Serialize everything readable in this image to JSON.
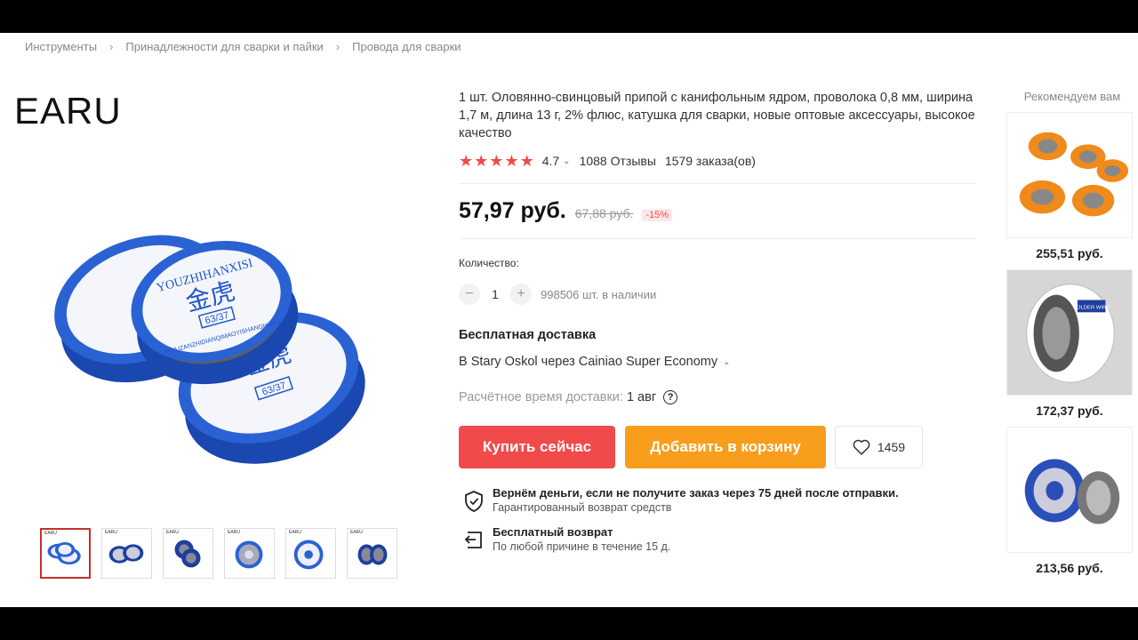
{
  "breadcrumb": [
    "Инструменты",
    "Принадлежности для сварки и пайки",
    "Провода для сварки"
  ],
  "brand": "EARU",
  "thumb_label": "EARU",
  "spool_texts": {
    "brand_text": "YOUZHIHANXISI",
    "chinese": "金虎",
    "alloy": "63/37",
    "side_text": "JINHUZANZHIDIANQIMAOYISHANGHANG"
  },
  "product": {
    "title": "1 шт. Оловянно-свинцовый припой с канифольным ядром, проволока 0,8 мм, ширина 1,7 м, длина 13 г, 2% флюс, катушка для сварки, новые оптовые аксессуары, высокое качество",
    "rating": "4.7",
    "stars": 5,
    "reviews": "1088 Отзывы",
    "orders": "1579 заказа(ов)",
    "price": "57,97 руб.",
    "old_price": "67,88 руб.",
    "discount": "-15%"
  },
  "quantity": {
    "label": "Количество:",
    "minus": "−",
    "value": "1",
    "plus": "+",
    "stock": "998506 шт. в наличии"
  },
  "shipping": {
    "title": "Бесплатная доставка",
    "method": "В Stary Oskol через Cainiao Super Economy",
    "eta_label": "Расчётное время доставки:",
    "eta_value": "1 авг",
    "help": "?"
  },
  "buttons": {
    "buy": "Купить сейчас",
    "cart": "Добавить в корзину",
    "wishlist_count": "1459"
  },
  "guarantees": [
    {
      "title": "Вернём деньги, если не получите заказ через 75 дней после отправки.",
      "subtitle": "Гарантированный возврат средств"
    },
    {
      "title": "Бесплатный возврат",
      "subtitle": "По любой причине в течение 15 д."
    }
  ],
  "recommend": {
    "title": "Рекомендуем вам",
    "items": [
      {
        "price": "255,51 руб."
      },
      {
        "price": "172,37 руб.",
        "label": "SOLDER WIRE"
      },
      {
        "price": "213,56 руб."
      }
    ]
  },
  "colors": {
    "buy": "#f04a4a",
    "cart": "#f99d1c",
    "star": "#f04a4a",
    "spool_blue": "#1f56c9"
  }
}
